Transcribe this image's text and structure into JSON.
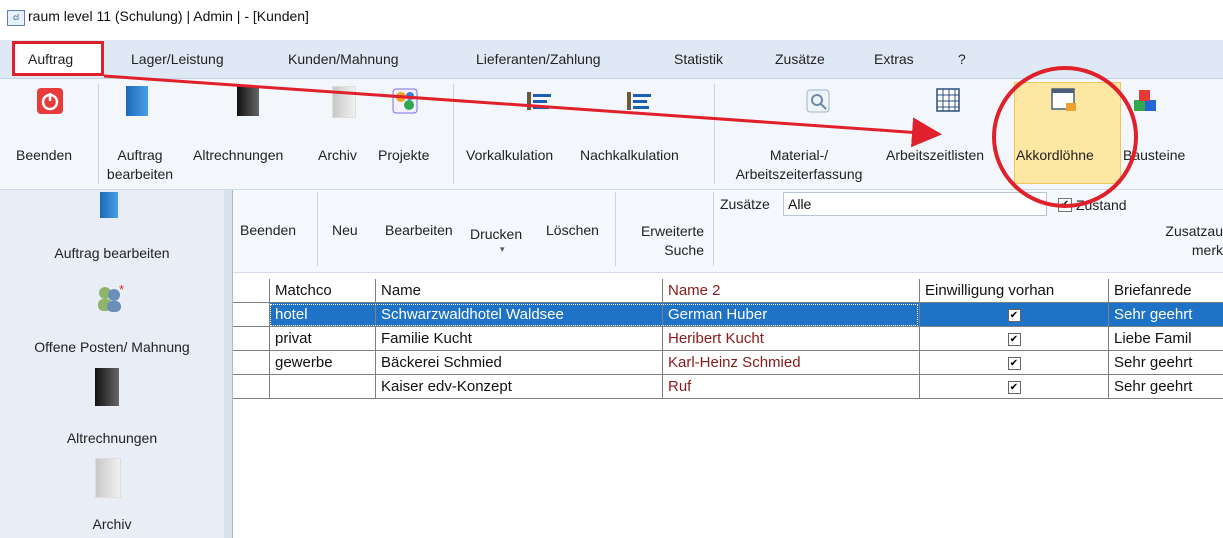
{
  "window": {
    "title": "raum level 11 (Schulung) | Admin | - [Kunden]",
    "app_icon": "app-logo-icon"
  },
  "menu": [
    "Auftrag",
    "Lager/Leistung",
    "Kunden/Mahnung",
    "Lieferanten/Zahlung",
    "Statistik",
    "Zusätze",
    "Extras",
    "?"
  ],
  "ribbon": {
    "beenden": "Beenden",
    "auftrag_bearbeiten_1": "Auftrag",
    "auftrag_bearbeiten_2": "bearbeiten",
    "altrechnungen": "Altrechnungen",
    "archiv": "Archiv",
    "projekte": "Projekte",
    "vorkalkulation": "Vorkalkulation",
    "nachkalkulation": "Nachkalkulation",
    "material_1": "Material-/",
    "material_2": "Arbeitszeiterfassung",
    "arbeitszeitlisten": "Arbeitszeitlisten",
    "akkordloehne": "Akkordlöhne",
    "bausteine": "Bausteine"
  },
  "sidebar": [
    {
      "label": "Auftrag bearbeiten"
    },
    {
      "label": "Offene Posten/ Mahnung"
    },
    {
      "label": "Altrechnungen"
    },
    {
      "label": "Archiv"
    }
  ],
  "toolbar": {
    "beenden": "Beenden",
    "neu": "Neu",
    "bearbeiten": "Bearbeiten",
    "drucken": "Drucken",
    "loeschen": "Löschen",
    "erweiterte_1": "Erweiterte",
    "erweiterte_2": "Suche",
    "zusaetze_label": "Zusätze",
    "zusaetze_value": "Alle",
    "zustand": "Zustand",
    "zusatz_1": "Zusatzau",
    "zusatz_2": "merk"
  },
  "grid": {
    "headers": [
      "Matchco",
      "Name",
      "Name 2",
      "Einwilligung vorhan",
      "Briefanrede"
    ],
    "rows": [
      {
        "matchco": "hotel",
        "name": "Schwarzwaldhotel Waldsee",
        "name2": "German Huber",
        "einwilligung": "✔",
        "briefanrede": "Sehr geehrt"
      },
      {
        "matchco": "privat",
        "name": "Familie Kucht",
        "name2": "Heribert Kucht",
        "einwilligung": "✔",
        "briefanrede": "Liebe Famil"
      },
      {
        "matchco": "gewerbe",
        "name": "Bäckerei Schmied",
        "name2": "Karl-Heinz Schmied",
        "einwilligung": "✔",
        "briefanrede": "Sehr geehrt"
      },
      {
        "matchco": "",
        "name": "Kaiser edv-Konzept",
        "name2": "Ruf",
        "einwilligung": "✔",
        "briefanrede": "Sehr geehrt"
      }
    ],
    "selected_row": 0
  },
  "colors": {
    "annotation": "#e0202a",
    "selection": "#1e73c7",
    "highlight": "#fde8a3"
  }
}
